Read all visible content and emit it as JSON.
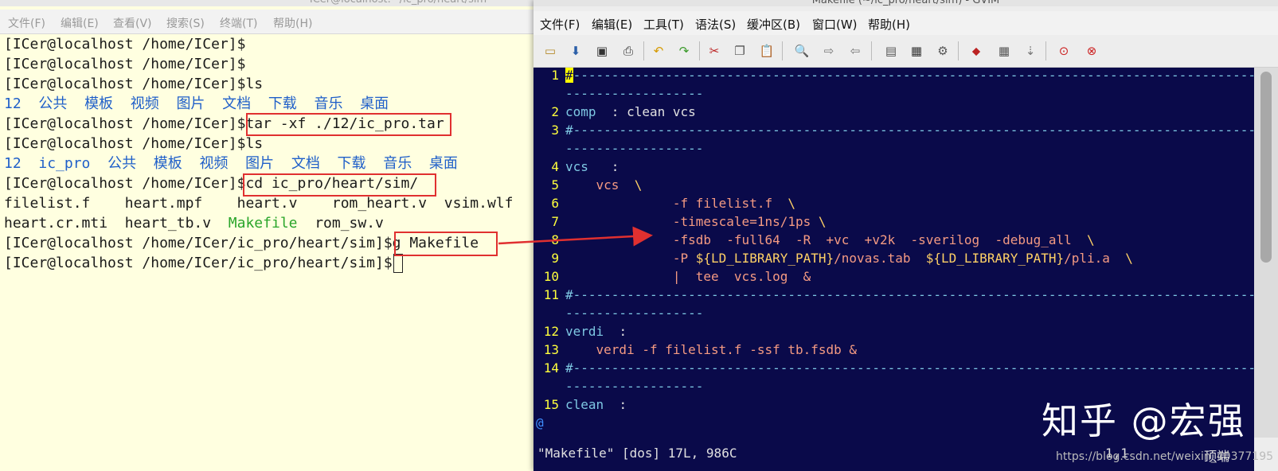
{
  "terminal": {
    "title": "ICer@localhost:~/ic_pro/heart/sim",
    "menu": [
      "文件(F)",
      "编辑(E)",
      "查看(V)",
      "搜索(S)",
      "终端(T)",
      "帮助(H)"
    ],
    "prompt_home": "[ICer@localhost /home/ICer]$",
    "prompt_sim": "[ICer@localhost /home/ICer/ic_pro/heart/sim]$",
    "cmd_ls": "ls",
    "cmd_tar": "tar -xf ./12/ic_pro.tar",
    "cmd_cd": "cd ic_pro/heart/sim/",
    "cmd_g": "g Makefile",
    "ls1": [
      "12",
      "公共",
      "模板",
      "视频",
      "图片",
      "文档",
      "下载",
      "音乐",
      "桌面"
    ],
    "ls2": [
      "12",
      "ic_pro",
      "公共",
      "模板",
      "视频",
      "图片",
      "文档",
      "下载",
      "音乐",
      "桌面"
    ],
    "files_row1": [
      "filelist.f",
      "heart.mpf",
      "heart.v",
      "rom_heart.v",
      "vsim.wlf"
    ],
    "files_row2": [
      "heart.cr.mti",
      "heart_tb.v",
      "Makefile",
      "rom_sw.v"
    ]
  },
  "vim": {
    "title": "Makefile (~/ic_pro/heart/sim) - GVIM",
    "menu": [
      "文件(F)",
      "编辑(E)",
      "工具(T)",
      "语法(S)",
      "缓冲区(B)",
      "窗口(W)",
      "帮助(H)"
    ],
    "toolbar_icons": [
      "open-icon",
      "save-icon",
      "save-all-icon",
      "print-icon",
      "undo-icon",
      "redo-icon",
      "cut-icon",
      "copy-icon",
      "paste-icon",
      "find-replace-icon",
      "find-next-icon",
      "find-prev-icon",
      "load-session-icon",
      "save-session-icon",
      "run-script-icon",
      "make-icon",
      "shell-icon",
      "ctags-icon",
      "help-icon",
      "find-help-icon"
    ],
    "code": {
      "l2_target": "comp",
      "l2_rest": "  : clean vcs",
      "l4_target": "vcs",
      "l4_rest": "   :",
      "l5_cmd": "vcs",
      "l5_bs": "  \\",
      "l6": "-f filelist.f  ",
      "l7": "-timescale=1ns/1ps ",
      "l8": "-fsdb  -full64  -R  +vc  +v2k  -sverilog  -debug_all  ",
      "l9_a": "-P ",
      "l9_var": "${LD_LIBRARY_PATH}",
      "l9_b": "/novas.tab  ",
      "l9_c": "/pli.a  ",
      "l10": "|  tee  vcs.log  &",
      "l12_target": "verdi",
      "l12_rest": "  :",
      "l13": "verdi -f filelist.f -ssf tb.fsdb &",
      "l15_target": "clean",
      "l15_rest": "  :",
      "backslash": "\\",
      "hash": "#"
    },
    "line_numbers": [
      "1",
      "2",
      "3",
      "4",
      "5",
      "6",
      "7",
      "8",
      "9",
      "10",
      "11",
      "12",
      "13",
      "14",
      "15"
    ],
    "status_file": "\"Makefile\" [dos] 17L, 986C",
    "status_pos": "1,1",
    "status_top": "顶端",
    "last_line_marker": "@"
  },
  "watermark": {
    "brand": "知乎 @宏强",
    "url": "https://blog.csdn.net/weixin_40377195"
  },
  "colors": {
    "terminal_bg": "#ffffe0",
    "vim_bg": "#0a0a4a",
    "highlight_box": "#e03030",
    "line_number": "#ffff3c"
  }
}
